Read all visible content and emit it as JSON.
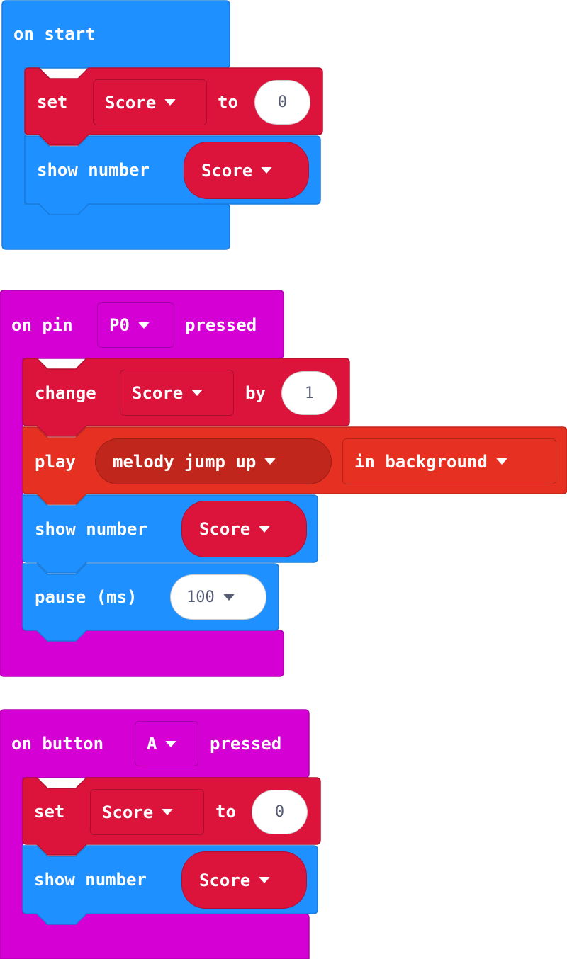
{
  "colors": {
    "basic_blue": "#1E90FF",
    "input_magenta": "#D400D4",
    "variables_red": "#DC143C",
    "music_red": "#E63022",
    "music_dark": "#C1261C",
    "number_text": "#575e75"
  },
  "scripts": [
    {
      "hat": {
        "label": "on start"
      },
      "blocks": [
        {
          "type": "set",
          "keyword": "set",
          "variable": "Score",
          "connector": "to",
          "value": "0"
        },
        {
          "type": "show_number",
          "keyword": "show number",
          "variable": "Score"
        }
      ]
    },
    {
      "hat": {
        "prefix": "on pin",
        "option": "P0",
        "suffix": "pressed"
      },
      "blocks": [
        {
          "type": "change",
          "keyword": "change",
          "variable": "Score",
          "connector": "by",
          "value": "1"
        },
        {
          "type": "play",
          "keyword": "play",
          "melody": "melody jump up",
          "mode": "in background"
        },
        {
          "type": "show_number",
          "keyword": "show number",
          "variable": "Score"
        },
        {
          "type": "pause",
          "keyword": "pause (ms)",
          "value": "100"
        }
      ]
    },
    {
      "hat": {
        "prefix": "on button",
        "option": "A",
        "suffix": "pressed"
      },
      "blocks": [
        {
          "type": "set",
          "keyword": "set",
          "variable": "Score",
          "connector": "to",
          "value": "0"
        },
        {
          "type": "show_number",
          "keyword": "show number",
          "variable": "Score"
        }
      ]
    }
  ]
}
